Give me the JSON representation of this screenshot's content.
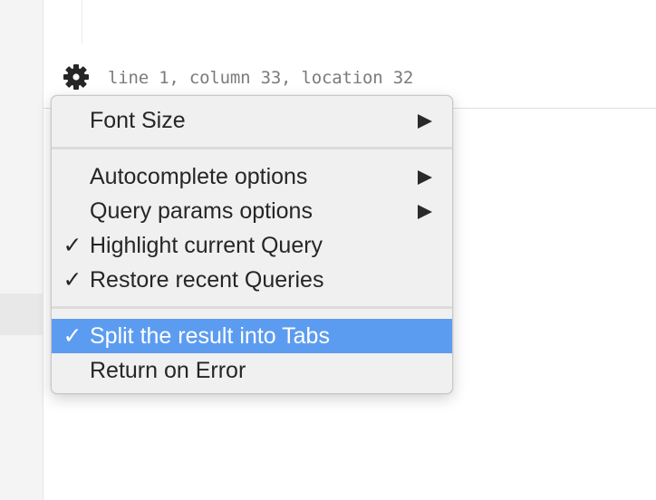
{
  "status": {
    "position_text": "line 1, column 33, location 32",
    "gear_icon": "gear-icon"
  },
  "menu": {
    "font_size": {
      "label": "Font Size",
      "has_submenu": true,
      "checked": false
    },
    "autocomplete": {
      "label": "Autocomplete options",
      "has_submenu": true,
      "checked": false
    },
    "query_params": {
      "label": "Query params options",
      "has_submenu": true,
      "checked": false
    },
    "highlight": {
      "label": "Highlight current Query",
      "check": "✓",
      "checked": true
    },
    "restore": {
      "label": "Restore recent Queries",
      "check": "✓",
      "checked": true
    },
    "split": {
      "label": "Split the result into Tabs",
      "check": "✓",
      "checked": true,
      "highlighted": true
    },
    "return_error": {
      "label": "Return on Error",
      "checked": false
    }
  },
  "colors": {
    "highlight": "#5c9cf0",
    "menu_bg": "#f0f0f0",
    "text": "#262626"
  }
}
